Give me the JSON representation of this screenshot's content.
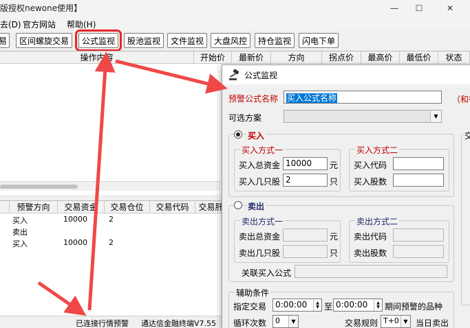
{
  "window": {
    "title": "版授权newone使用】",
    "controls": [
      "—",
      "☐",
      "✕"
    ]
  },
  "menu": [
    "去(D)",
    "官方网站",
    "帮助(H)"
  ],
  "toolbar": {
    "buttons": [
      "易",
      "区间螺旋交易",
      "公式监视",
      "股池监视",
      "文件监视",
      "大盘风控",
      "持仓监视",
      "闪电下单"
    ]
  },
  "top_grid": {
    "headers": [
      "操作内容",
      "开始价",
      "最新价",
      "方向",
      "拐点价",
      "最高价",
      "最低价",
      "状态"
    ]
  },
  "bottom_grid": {
    "headers": [
      "预警方向",
      "交易资金",
      "交易仓位",
      "交易代码",
      "交易肝"
    ],
    "rows": [
      {
        "direction": "买入",
        "funds": "10000",
        "position": "2"
      },
      {
        "direction": "卖出",
        "funds": "",
        "position": ""
      },
      {
        "direction": "买入",
        "funds": "10000",
        "position": "2"
      }
    ]
  },
  "statusbar": {
    "connected": "已连接行情预警",
    "terminal": "通达信金融终端V7.55"
  },
  "dialog": {
    "title": "公式监视",
    "formula_name_label": "预警公式名称",
    "formula_name_value": "买入公式名称",
    "right_note": "（和行",
    "scheme_label": "可选方案",
    "scheme_value": "",
    "buy": {
      "label": "买入",
      "mode1_title": "买入方式一",
      "total_funds_label": "买入总资金",
      "total_funds_value": "10000",
      "yuan": "元",
      "shares_label": "买入几只股",
      "shares_value": "2",
      "zhi": "只",
      "mode2_title": "买入方式二",
      "code_label": "买入代码",
      "count_label": "买入股数"
    },
    "sell": {
      "label": "卖出",
      "mode1_title": "卖出方式一",
      "total_funds_label": "卖出总资金",
      "yuan": "元",
      "shares_label": "卖出几只股",
      "zhi": "只",
      "mode2_title": "卖出方式二",
      "code_label": "卖出代码",
      "count_label": "卖出股数",
      "related_label": "关联买入公式"
    },
    "aux": {
      "title": "辅助条件",
      "trade_label": "指定交易",
      "time_from": "0:00:00",
      "to_label": "至",
      "time_to": "0:00:00",
      "period_label": "期间预警的品种",
      "loop_label": "循环次数",
      "loop_value": "0",
      "rule_label": "交易规则",
      "rule_value": "T+0",
      "sell_today": "当日卖出"
    },
    "side_label": "交"
  },
  "colors": {
    "highlight": "#e8262b",
    "arrow": "#f04848",
    "red_label": "#c00000",
    "selection": "#0078d7"
  }
}
